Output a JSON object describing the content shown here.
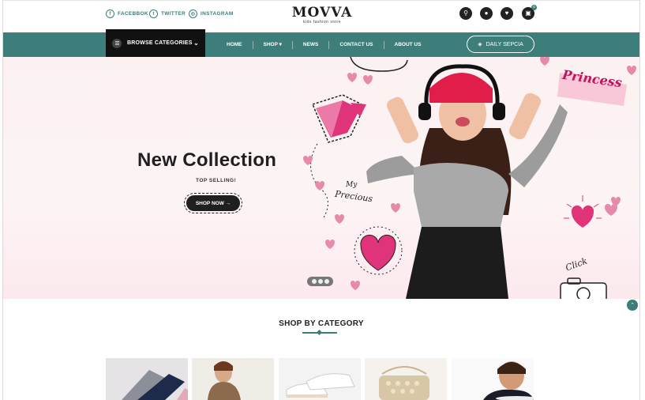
{
  "social": [
    {
      "icon": "facebook-icon",
      "glyph": "f",
      "label": "FACEBBOK"
    },
    {
      "icon": "twitter-icon",
      "glyph": "t",
      "label": "TWITTER"
    },
    {
      "icon": "instagram-icon",
      "glyph": "◎",
      "label": "INSTAGRAM"
    }
  ],
  "logo": {
    "brand": "MOVVA",
    "tagline": "kids fashion store"
  },
  "header_icons": [
    {
      "name": "search-icon",
      "glyph": "⚲"
    },
    {
      "name": "account-icon",
      "glyph": "●"
    },
    {
      "name": "wishlist-icon",
      "glyph": "♥"
    },
    {
      "name": "cart-icon",
      "glyph": "▣",
      "badge": "0"
    }
  ],
  "nav": {
    "browse_label": "BROWSE CATEGORIES",
    "links": [
      "HOME",
      "SHOP ▾",
      "NEWS",
      "CONTACT US",
      "ABOUT US"
    ],
    "daily_label": "DAILY SEPCIA"
  },
  "hero": {
    "title": "New Collection",
    "subtitle": "TOP SELLING!",
    "button": "SHOP NOW →",
    "decor_text_1": "Princess",
    "decor_text_2": "My",
    "decor_text_3": "Precious",
    "decor_text_4": "Click"
  },
  "category": {
    "title": "SHOP BY CATEGORY"
  },
  "colors": {
    "accent": "#3d7d7a",
    "pink": "#e0347a",
    "dark": "#1f1f1f"
  }
}
